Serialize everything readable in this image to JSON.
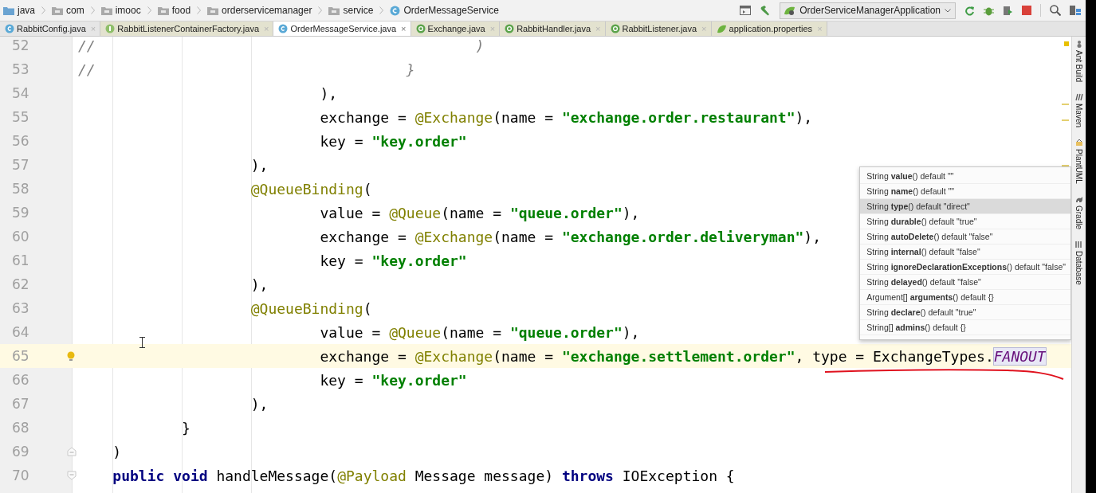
{
  "breadcrumbs": [
    {
      "label": "java",
      "kind": "source-folder"
    },
    {
      "label": "com",
      "kind": "package"
    },
    {
      "label": "imooc",
      "kind": "package"
    },
    {
      "label": "food",
      "kind": "package"
    },
    {
      "label": "orderservicemanager",
      "kind": "package"
    },
    {
      "label": "service",
      "kind": "package"
    },
    {
      "label": "OrderMessageService",
      "kind": "class"
    }
  ],
  "run_configuration": "OrderServiceManagerApplication",
  "tabs": [
    {
      "label": "RabbitConfig.java",
      "kind": "class",
      "selected": false
    },
    {
      "label": "RabbitListenerContainerFactory.java",
      "kind": "interface",
      "selected": false
    },
    {
      "label": "OrderMessageService.java",
      "kind": "class",
      "selected": true
    },
    {
      "label": "Exchange.java",
      "kind": "annotation",
      "selected": false
    },
    {
      "label": "RabbitHandler.java",
      "kind": "annotation",
      "selected": false
    },
    {
      "label": "RabbitListener.java",
      "kind": "annotation",
      "selected": false
    },
    {
      "label": "application.properties",
      "kind": "properties",
      "selected": false
    }
  ],
  "close_glyph": "×",
  "lines": [
    {
      "number": "52",
      "current": false,
      "tokens": [
        {
          "kind": "comment",
          "text": "//                                            )"
        }
      ]
    },
    {
      "number": "53",
      "current": false,
      "tokens": [
        {
          "kind": "comment",
          "text": "//                                    }"
        }
      ]
    },
    {
      "number": "54",
      "current": false,
      "tokens": [
        {
          "kind": "plain",
          "text": "                            ),"
        }
      ]
    },
    {
      "number": "55",
      "current": false,
      "tokens": [
        {
          "kind": "plain",
          "text": "                            exchange = "
        },
        {
          "kind": "annotation",
          "text": "@Exchange"
        },
        {
          "kind": "plain",
          "text": "(name = "
        },
        {
          "kind": "string",
          "text": "\"exchange.order.restaurant\""
        },
        {
          "kind": "plain",
          "text": "),"
        }
      ]
    },
    {
      "number": "56",
      "current": false,
      "tokens": [
        {
          "kind": "plain",
          "text": "                            key = "
        },
        {
          "kind": "string",
          "text": "\"key.order\""
        }
      ]
    },
    {
      "number": "57",
      "current": false,
      "tokens": [
        {
          "kind": "plain",
          "text": "                    ),"
        }
      ]
    },
    {
      "number": "58",
      "current": false,
      "tokens": [
        {
          "kind": "annotation",
          "text": "                    @QueueBinding"
        },
        {
          "kind": "plain",
          "text": "("
        }
      ]
    },
    {
      "number": "59",
      "current": false,
      "tokens": [
        {
          "kind": "plain",
          "text": "                            value = "
        },
        {
          "kind": "annotation",
          "text": "@Queue"
        },
        {
          "kind": "plain",
          "text": "(name = "
        },
        {
          "kind": "string",
          "text": "\"queue.order\""
        },
        {
          "kind": "plain",
          "text": "),"
        }
      ]
    },
    {
      "number": "60",
      "current": false,
      "tokens": [
        {
          "kind": "plain",
          "text": "                            exchange = "
        },
        {
          "kind": "annotation",
          "text": "@Exchange"
        },
        {
          "kind": "plain",
          "text": "(name = "
        },
        {
          "kind": "string",
          "text": "\"exchange.order.deliveryman\""
        },
        {
          "kind": "plain",
          "text": "),"
        }
      ]
    },
    {
      "number": "61",
      "current": false,
      "tokens": [
        {
          "kind": "plain",
          "text": "                            key = "
        },
        {
          "kind": "string",
          "text": "\"key.order\""
        }
      ]
    },
    {
      "number": "62",
      "current": false,
      "tokens": [
        {
          "kind": "plain",
          "text": "                    ),"
        }
      ]
    },
    {
      "number": "63",
      "current": false,
      "tokens": [
        {
          "kind": "annotation",
          "text": "                    @QueueBinding"
        },
        {
          "kind": "plain",
          "text": "("
        }
      ]
    },
    {
      "number": "64",
      "current": false,
      "tokens": [
        {
          "kind": "plain",
          "text": "                            value = "
        },
        {
          "kind": "annotation",
          "text": "@Queue"
        },
        {
          "kind": "plain",
          "text": "(name = "
        },
        {
          "kind": "string",
          "text": "\"queue.order\""
        },
        {
          "kind": "plain",
          "text": "),"
        }
      ]
    },
    {
      "number": "65",
      "current": true,
      "kind": "bulb",
      "tokens": [
        {
          "kind": "plain",
          "text": "                            exchange = "
        },
        {
          "kind": "annotation",
          "text": "@Exchange"
        },
        {
          "kind": "plain",
          "text": "(name = "
        },
        {
          "kind": "string",
          "text": "\"exchange.settlement.order\""
        },
        {
          "kind": "plain",
          "text": ", type = ExchangeTypes."
        },
        {
          "kind": "constant",
          "text": "FANOUT"
        }
      ]
    },
    {
      "number": "66",
      "current": false,
      "tokens": [
        {
          "kind": "plain",
          "text": "                            key = "
        },
        {
          "kind": "string",
          "text": "\"key.order\""
        }
      ]
    },
    {
      "number": "67",
      "current": false,
      "tokens": [
        {
          "kind": "plain",
          "text": "                    ),"
        }
      ]
    },
    {
      "number": "68",
      "current": false,
      "tokens": [
        {
          "kind": "plain",
          "text": "            }"
        }
      ]
    },
    {
      "number": "69",
      "current": false,
      "kind": "fold-end",
      "tokens": [
        {
          "kind": "plain",
          "text": "    )"
        }
      ]
    },
    {
      "number": "70",
      "current": false,
      "kind": "fold-start",
      "tokens": [
        {
          "kind": "keyword",
          "text": "    public void"
        },
        {
          "kind": "plain",
          "text": " handleMessage("
        },
        {
          "kind": "annotation",
          "text": "@Payload"
        },
        {
          "kind": "plain",
          "text": " Message message) "
        },
        {
          "kind": "keyword",
          "text": "throws"
        },
        {
          "kind": "plain",
          "text": " IOException {"
        }
      ]
    }
  ],
  "completion": [
    {
      "text": "String **value**() default \"\"",
      "selected": false
    },
    {
      "text": "String **name**() default \"\"",
      "selected": false
    },
    {
      "text": "String **type**() default \"direct\"",
      "selected": true
    },
    {
      "text": "String **durable**() default \"true\"",
      "selected": false
    },
    {
      "text": "String **autoDelete**() default \"false\"",
      "selected": false
    },
    {
      "text": "String **internal**() default \"false\"",
      "selected": false
    },
    {
      "text": "String **ignoreDeclarationExceptions**() default \"false\"",
      "selected": false
    },
    {
      "text": "String **delayed**() default \"false\"",
      "selected": false
    },
    {
      "text": "Argument[] **arguments**() default {}",
      "selected": false
    },
    {
      "text": "String **declare**() default \"true\"",
      "selected": false
    },
    {
      "text": "String[] **admins**() default {}",
      "selected": false
    }
  ],
  "tool_windows": [
    {
      "label": "Ant Build",
      "kind": "ant"
    },
    {
      "label": "Maven",
      "kind": "maven"
    },
    {
      "label": "PlantUML",
      "kind": "plantuml"
    },
    {
      "label": "Gradle",
      "kind": "gradle"
    },
    {
      "label": "Database",
      "kind": "database"
    }
  ]
}
